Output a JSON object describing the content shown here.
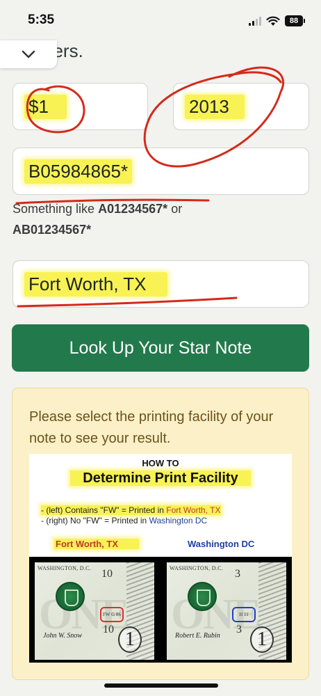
{
  "status_bar": {
    "time": "5:35",
    "battery_level": "88",
    "icons": [
      "cellular-signal-icon",
      "wifi-icon",
      "battery-icon"
    ]
  },
  "page": {
    "partial_heading": "bers.",
    "collapse_icon": "chevron-down-icon"
  },
  "form": {
    "denomination_value": "$1",
    "series_value": "2013",
    "serial_value": "B05984865*",
    "serial_hint_prefix": "Something like",
    "serial_hint_example1": "A01234567*",
    "serial_hint_or": "or",
    "serial_hint_example2": "AB01234567*",
    "facility_value": "Fort Worth, TX",
    "submit_label": "Look Up Your Star Note"
  },
  "result": {
    "message": "Please select the printing facility of your note to see your result."
  },
  "illustration": {
    "how_to": "HOW TO",
    "title": "Determine Print Facility",
    "line1_prefix": "- (left) Contains \"FW\" = Printed in",
    "line1_place": "Fort Worth, TX",
    "line2_prefix": "- (right) No \"FW\" = Printed in",
    "line2_place": "Washington DC",
    "left_label": "Fort Worth, TX",
    "right_label": "Washington DC",
    "left_bill": {
      "issuer": "WASHINGTON, D.C.",
      "top_number": "10",
      "bottom_number": "10",
      "plate_mark": "FW G 86",
      "corner_numeral": "1",
      "signature": "John W. Snow"
    },
    "right_bill": {
      "issuer": "WASHINGTON, D.C.",
      "top_number": "3",
      "bottom_number": "3",
      "plate_mark": "H 11",
      "corner_numeral": "1",
      "signature": "Robert E. Rubin"
    }
  },
  "colors": {
    "button": "#227a4c",
    "panel": "#fcf0c8",
    "panel_text": "#6a531c",
    "highlight": "#f8f254",
    "annotation_red": "#d42a1a",
    "fort_worth_red": "#c0392b",
    "washington_blue": "#1f3fa0"
  }
}
